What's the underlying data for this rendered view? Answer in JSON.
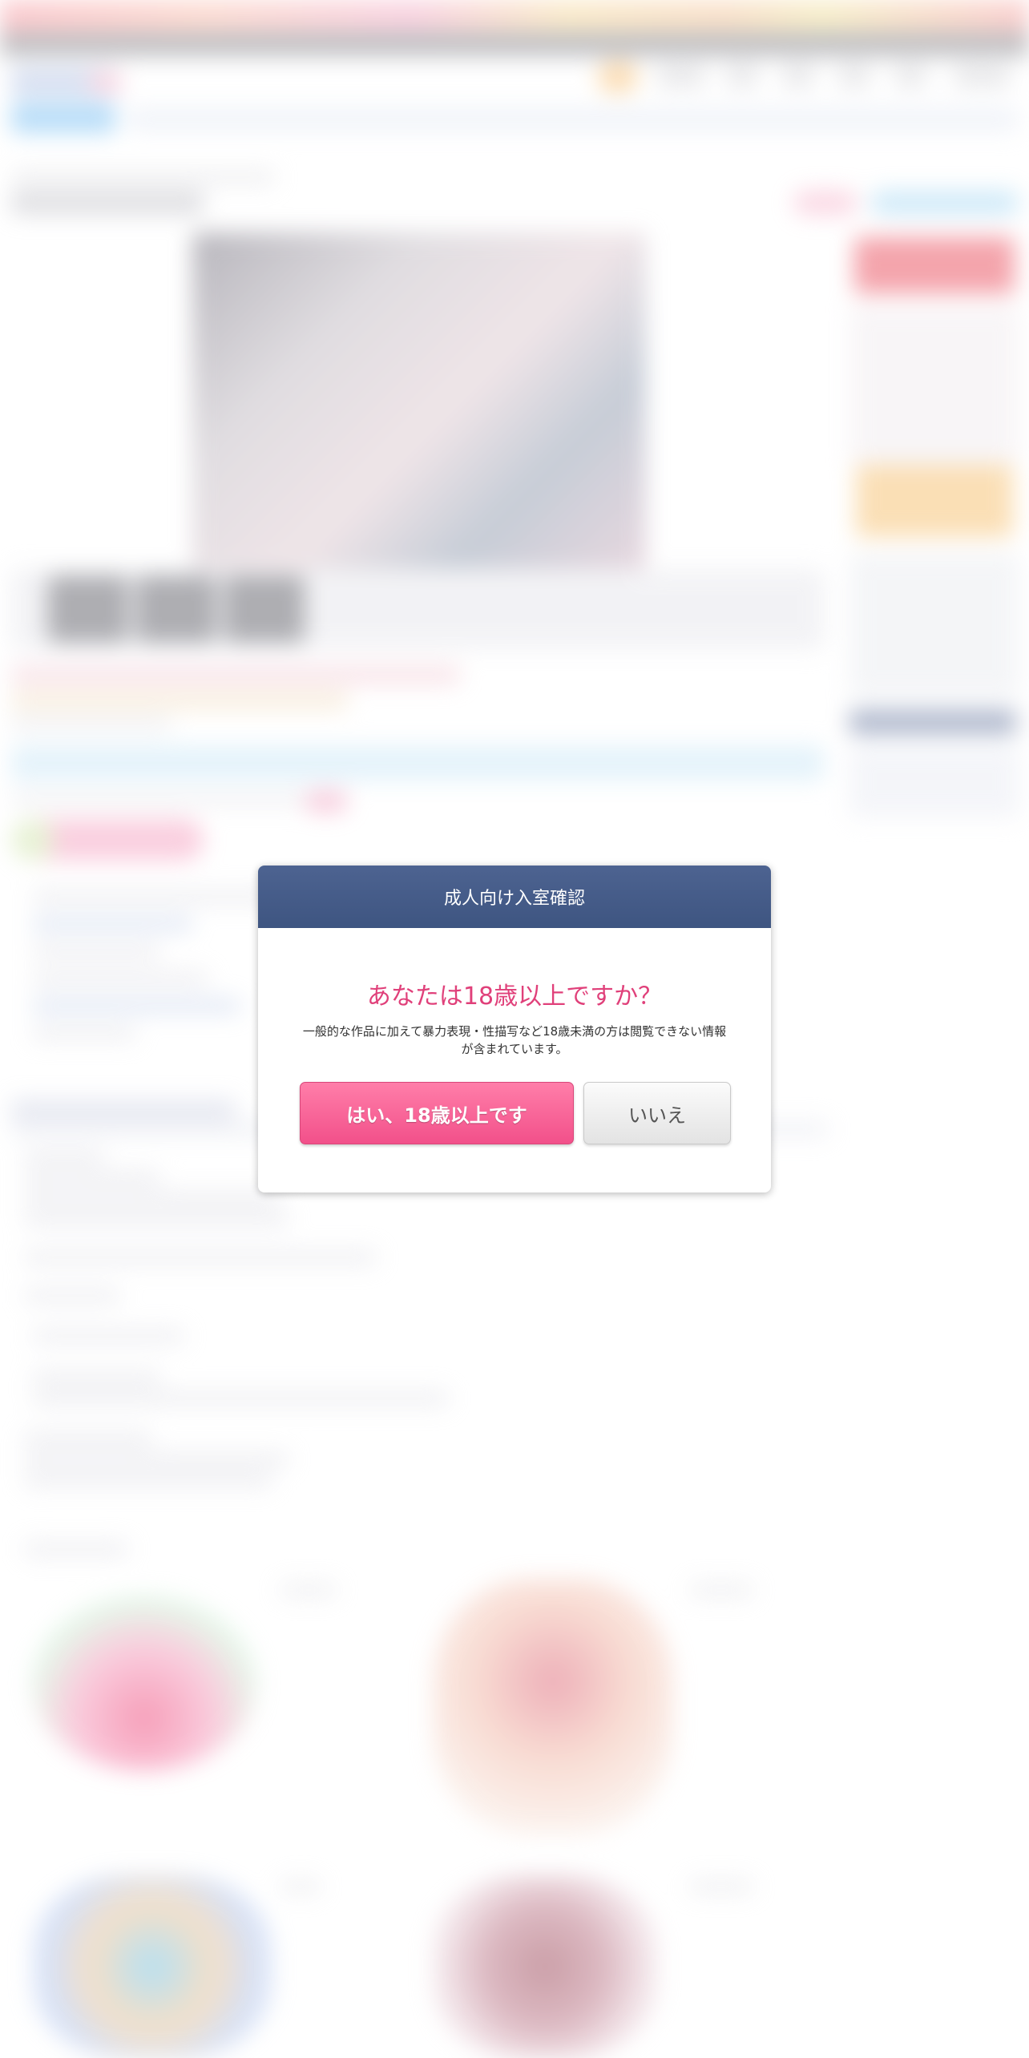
{
  "modal": {
    "header_title": "成人向け入室確認",
    "question": "あなたは18歳以上ですか？",
    "description": "一般的な作品に加えて暴力表現・性描写など18歳未満の方は閲覧できない情報が含まれています。",
    "yes_label": "はい、18歳以上です",
    "no_label": "いいえ"
  },
  "colors": {
    "header_bg": "#465b89",
    "question_text": "#e0407a",
    "yes_button": "#f2508a",
    "no_button": "#e8e8e8"
  }
}
